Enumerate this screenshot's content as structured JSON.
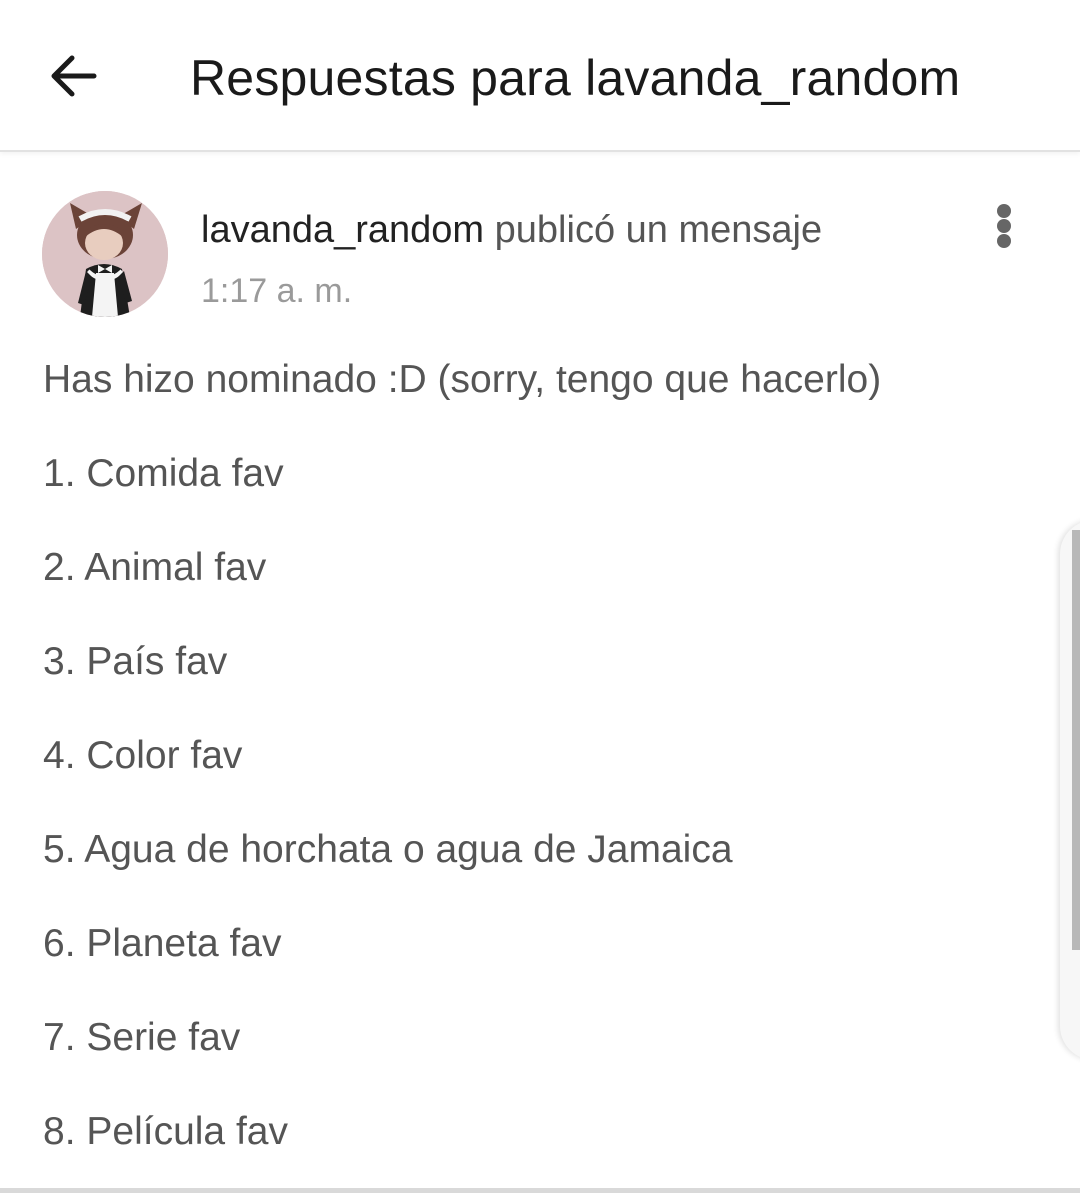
{
  "header": {
    "back_icon": "arrow-left-icon",
    "title": "Respuestas para lavanda_random"
  },
  "post": {
    "avatar_icon": "user-avatar",
    "author": "lavanda_random",
    "action": " publicó un mensaje",
    "time": "1:17 a. m.",
    "more_icon": "more-vertical-icon",
    "lines": [
      "Has hizo nominado :D (sorry, tengo que hacerlo)",
      "1. Comida fav",
      "2. Animal fav",
      "3. País fav",
      "4. Color fav",
      "5. Agua de horchata o agua de Jamaica",
      "6. Planeta fav",
      "7. Serie fav",
      "8. Película fav"
    ]
  },
  "colors": {
    "avatar_bg": "#dcc3c5",
    "text_primary": "#222222",
    "text_secondary": "#555555",
    "text_muted": "#9a9a9a"
  }
}
